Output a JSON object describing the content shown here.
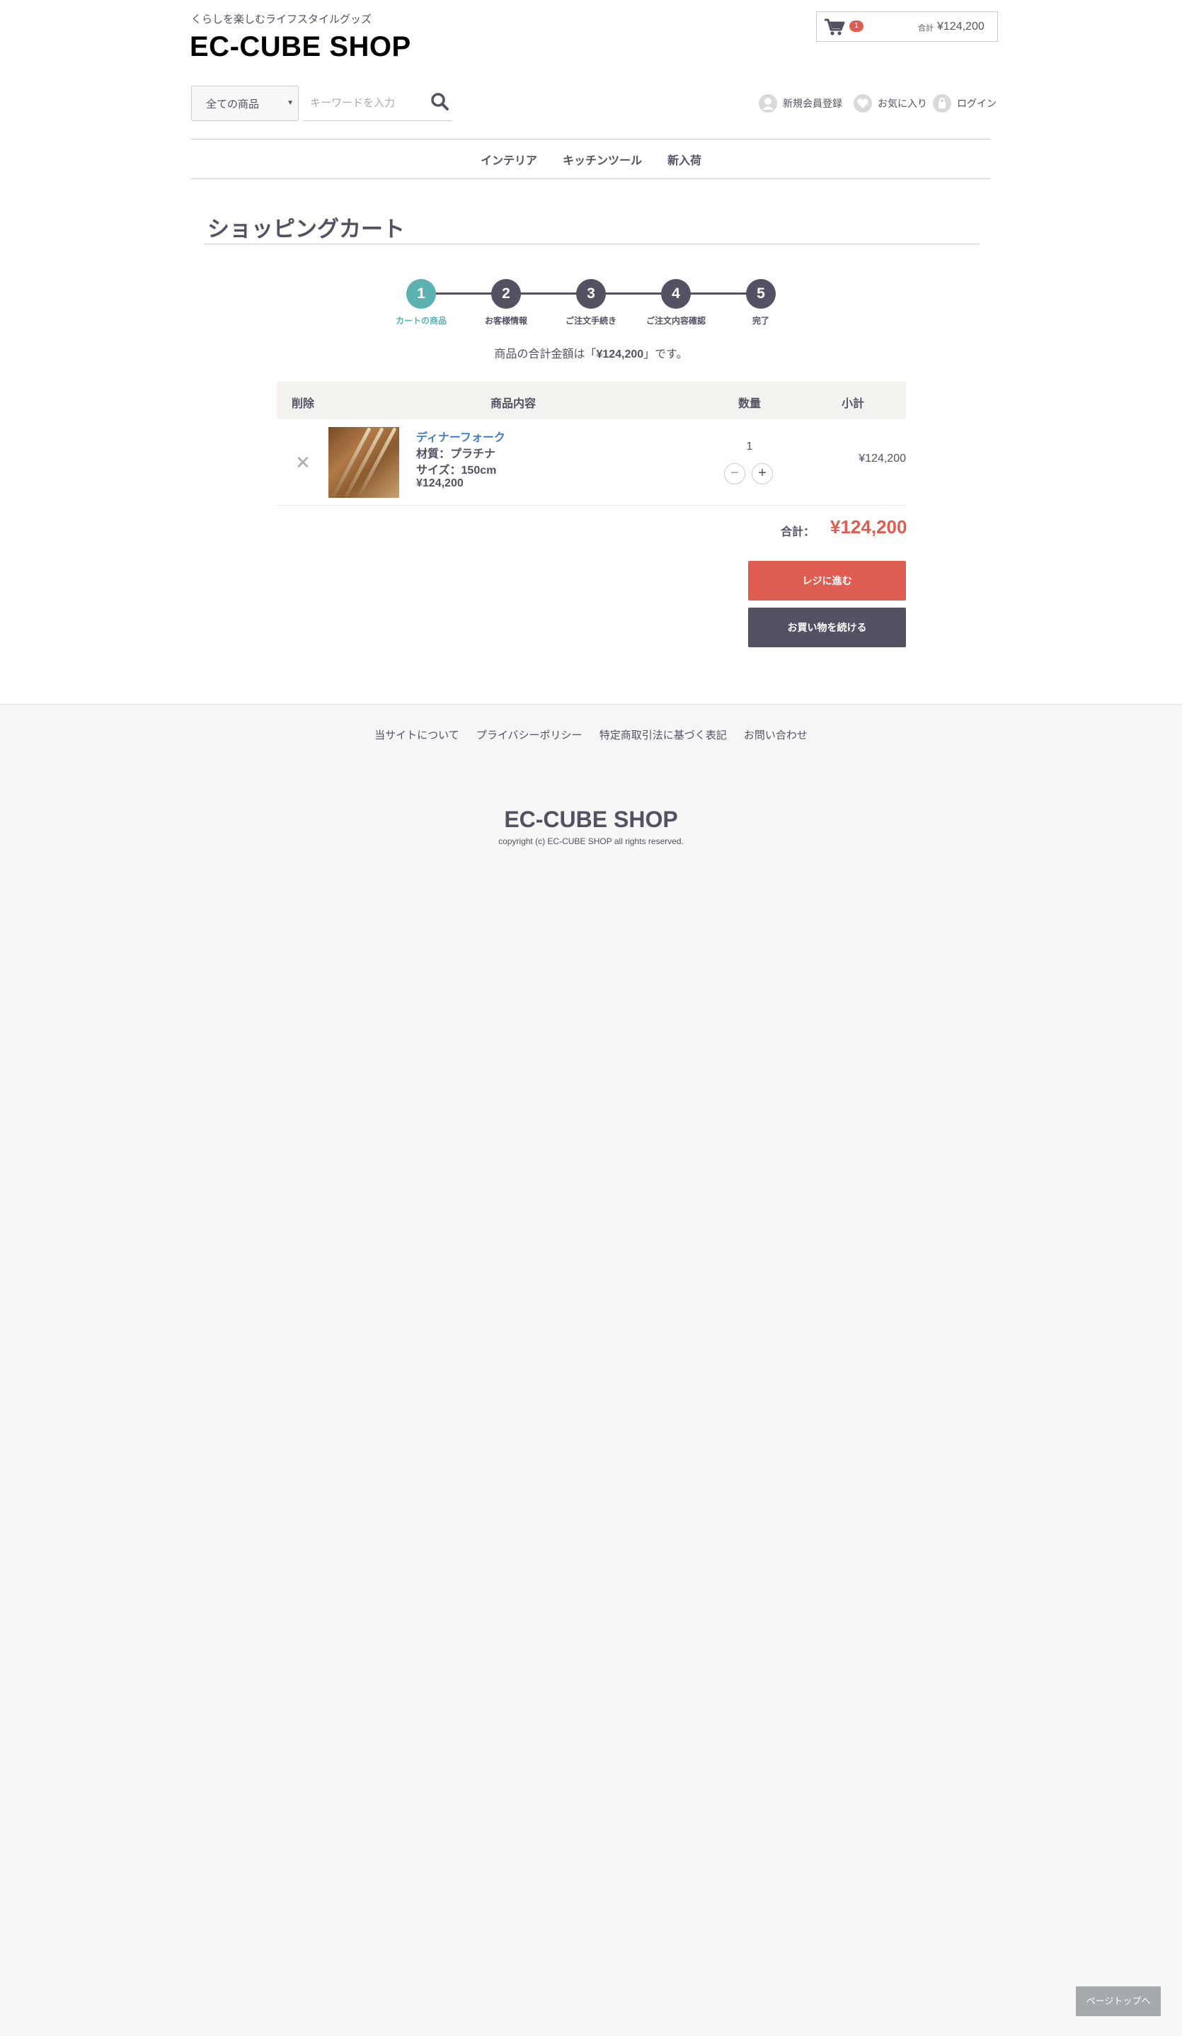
{
  "header": {
    "tagline": "くらしを楽しむライフスタイルグッズ",
    "logo": "EC-CUBE SHOP",
    "cart": {
      "count": "1",
      "total_label": "合計",
      "total": "¥124,200"
    },
    "search": {
      "category": "全ての商品",
      "placeholder": "キーワードを入力"
    },
    "member_links": [
      "新規会員登録",
      "お気に入り",
      "ログイン"
    ]
  },
  "nav": [
    "インテリア",
    "キッチンツール",
    "新入荷"
  ],
  "page_title": "ショッピングカート",
  "steps": [
    {
      "num": "1",
      "label": "カートの商品",
      "active": true
    },
    {
      "num": "2",
      "label": "お客様情報",
      "active": false
    },
    {
      "num": "3",
      "label": "ご注文手続き",
      "active": false
    },
    {
      "num": "4",
      "label": "ご注文内容確認",
      "active": false
    },
    {
      "num": "5",
      "label": "完了",
      "active": false
    }
  ],
  "total_message": {
    "before": "商品の合計金額は「",
    "amount": "¥124,200",
    "after": "」です。"
  },
  "cart_table": {
    "headers": [
      "削除",
      "商品内容",
      "数量",
      "小計"
    ],
    "rows": [
      {
        "name": "ディナーフォーク",
        "material": "材質：プラチナ",
        "size": "サイズ：150cm",
        "price": "¥124,200",
        "quantity": "1",
        "subtotal": "¥124,200"
      }
    ]
  },
  "grand_total": {
    "label": "合計：",
    "value": "¥124,200"
  },
  "buttons": {
    "checkout": "レジに進む",
    "continue": "お買い物を続ける"
  },
  "footer": {
    "links": [
      "当サイトについて",
      "プライバシーポリシー",
      "特定商取引法に基づく表記",
      "お問い合わせ"
    ],
    "logo": "EC-CUBE SHOP",
    "copyright": "copyright (c) EC-CUBE SHOP all rights reserved."
  },
  "pagetop": "ページトップへ"
}
